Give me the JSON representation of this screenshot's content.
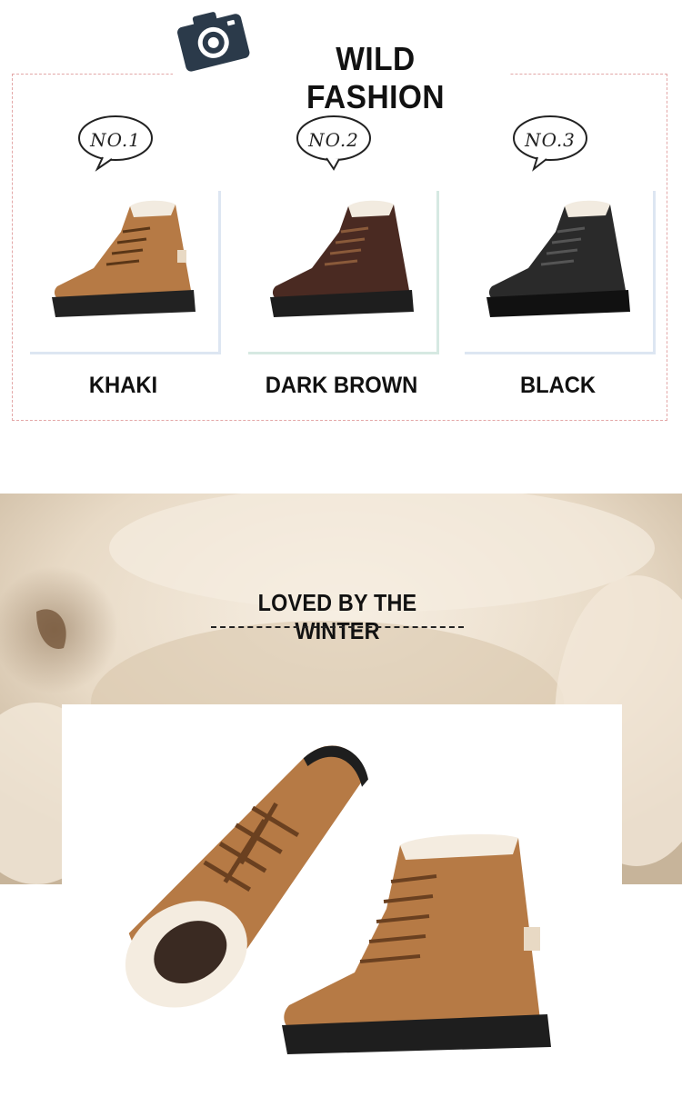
{
  "header": {
    "title": "WILD FASHION",
    "icon": "camera-icon"
  },
  "variants": [
    {
      "badge": "NO.1",
      "color_name": "KHAKI",
      "boot_color": "#b67a45",
      "accent": "#dde6f2"
    },
    {
      "badge": "NO.2",
      "color_name": "DARK BROWN",
      "boot_color": "#4a2a22",
      "accent": "#d6e9e2"
    },
    {
      "badge": "NO.3",
      "color_name": "BLACK",
      "boot_color": "#2a2a2a",
      "accent": "#dde6f2"
    }
  ],
  "feature": {
    "title": "LOVED BY THE WINTER"
  },
  "colors": {
    "frame_border": "#e3a7a7",
    "fur": "#efe4d4",
    "khaki": "#b67a45"
  }
}
